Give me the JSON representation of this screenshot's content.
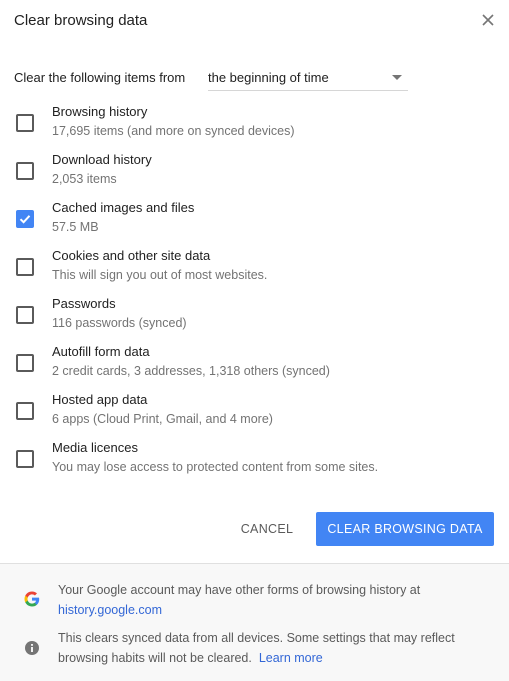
{
  "dialog": {
    "title": "Clear browsing data",
    "close_icon": "close-icon"
  },
  "range": {
    "label": "Clear the following items from",
    "selected": "the beginning of time"
  },
  "items": [
    {
      "label": "Browsing history",
      "desc": "17,695 items (and more on synced devices)",
      "checked": false
    },
    {
      "label": "Download history",
      "desc": "2,053 items",
      "checked": false
    },
    {
      "label": "Cached images and files",
      "desc": "57.5 MB",
      "checked": true
    },
    {
      "label": "Cookies and other site data",
      "desc": "This will sign you out of most websites.",
      "checked": false
    },
    {
      "label": "Passwords",
      "desc": "116 passwords (synced)",
      "checked": false
    },
    {
      "label": "Autofill form data",
      "desc": "2 credit cards, 3 addresses, 1,318 others (synced)",
      "checked": false
    },
    {
      "label": "Hosted app data",
      "desc": "6 apps (Cloud Print, Gmail, and 4 more)",
      "checked": false
    },
    {
      "label": "Media licences",
      "desc": "You may lose access to protected content from some sites.",
      "checked": false
    }
  ],
  "buttons": {
    "cancel": "CANCEL",
    "clear": "CLEAR BROWSING DATA"
  },
  "footer": {
    "google_note": "Your Google account may have other forms of browsing history at",
    "google_link": "history.google.com",
    "sync_note": "This clears synced data from all devices. Some settings that may reflect browsing habits will not be cleared.",
    "learn_more": "Learn more"
  },
  "colors": {
    "accent": "#4285f4",
    "link": "#3367d6"
  }
}
